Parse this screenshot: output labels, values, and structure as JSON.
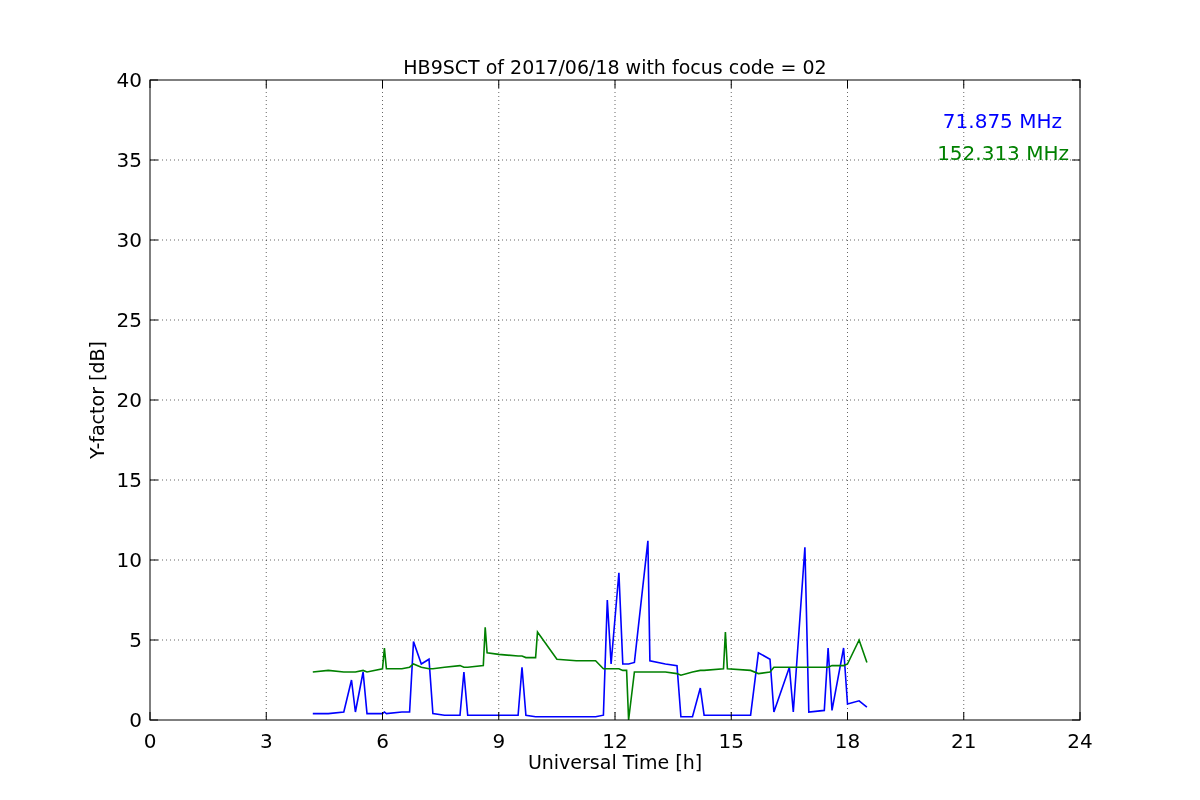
{
  "chart_data": {
    "type": "line",
    "grid": true,
    "title": "HB9SCT of 2017/06/18 with focus code = 02",
    "xlabel": "Universal Time [h]",
    "ylabel": "Y-factor [dB]",
    "xlim": [
      0,
      24
    ],
    "ylim": [
      0,
      40
    ],
    "xticks": [
      0,
      3,
      6,
      9,
      12,
      15,
      18,
      21,
      24
    ],
    "yticks": [
      0,
      5,
      10,
      15,
      20,
      25,
      30,
      35,
      40
    ],
    "x": [
      4.2,
      4.6,
      5.0,
      5.2,
      5.3,
      5.5,
      5.6,
      6.0,
      6.05,
      6.1,
      6.5,
      6.7,
      6.8,
      7.0,
      7.2,
      7.3,
      7.6,
      8.0,
      8.1,
      8.2,
      8.6,
      8.65,
      8.7,
      9.0,
      9.5,
      9.6,
      9.7,
      9.95,
      10.0,
      10.5,
      11.0,
      11.5,
      11.7,
      11.8,
      11.9,
      12.1,
      12.2,
      12.3,
      12.35,
      12.5,
      12.85,
      12.9,
      13.3,
      13.6,
      13.7,
      14.0,
      14.2,
      14.3,
      14.8,
      14.85,
      14.9,
      15.5,
      15.7,
      16.0,
      16.1,
      16.5,
      16.6,
      16.9,
      17.0,
      17.4,
      17.5,
      17.6,
      17.9,
      18.0,
      18.3,
      18.5
    ],
    "series": [
      {
        "name": "71.875 MHz",
        "color": "#0000ff",
        "values": [
          0.4,
          0.4,
          0.5,
          2.5,
          0.5,
          3,
          0.4,
          0.4,
          0.5,
          0.4,
          0.5,
          0.5,
          4.9,
          3.5,
          3.8,
          0.4,
          0.3,
          0.3,
          3,
          0.3,
          0.3,
          0.3,
          0.3,
          0.3,
          0.3,
          3.3,
          0.3,
          0.2,
          0.2,
          0.2,
          0.2,
          0.2,
          0.3,
          7.5,
          3.5,
          9.2,
          3.5,
          3.5,
          3.5,
          3.6,
          11.2,
          3.7,
          3.5,
          3.4,
          0.2,
          0.2,
          2,
          0.3,
          0.3,
          0.3,
          0.3,
          0.3,
          4.2,
          3.8,
          0.5,
          3.3,
          0.5,
          10.8,
          0.5,
          0.6,
          4.5,
          0.6,
          4.5,
          1,
          1.2,
          0.8
        ]
      },
      {
        "name": "152.313 MHz",
        "color": "#008000",
        "values": [
          3.0,
          3.1,
          3.0,
          3.0,
          3.0,
          3.1,
          3.0,
          3.2,
          4.5,
          3.2,
          3.2,
          3.3,
          3.5,
          3.3,
          3.2,
          3.2,
          3.3,
          3.4,
          3.3,
          3.3,
          3.4,
          5.8,
          4.2,
          4.1,
          4.0,
          4.0,
          3.9,
          3.9,
          5.5,
          3.8,
          3.7,
          3.7,
          3.2,
          3.2,
          3.2,
          3.2,
          3.1,
          3.1,
          0.0,
          3.0,
          3.0,
          3.0,
          3.0,
          2.9,
          2.8,
          3.0,
          3.1,
          3.1,
          3.2,
          5.5,
          3.2,
          3.1,
          2.9,
          3.0,
          3.3,
          3.3,
          3.3,
          3.3,
          3.3,
          3.3,
          3.3,
          3.4,
          3.4,
          3.5,
          5.0,
          3.6
        ]
      }
    ]
  }
}
